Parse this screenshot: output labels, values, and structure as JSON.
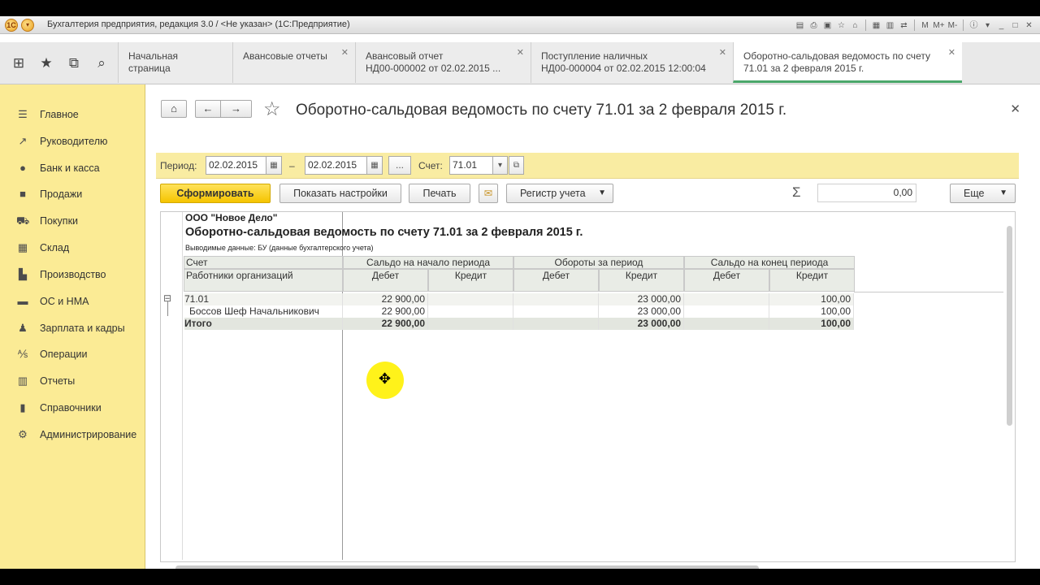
{
  "window": {
    "title": "Бухгалтерия предприятия, редакция 3.0 / <Не указан>  (1С:Предприятие)",
    "logo_text": "1С"
  },
  "tabs": [
    {
      "label": "Начальная страница"
    },
    {
      "label": "Авансовые отчеты"
    },
    {
      "line1": "Авансовый отчет",
      "line2": "НД00-000002 от 02.02.2015 ..."
    },
    {
      "line1": "Поступление наличных",
      "line2": "НД00-000004 от 02.02.2015 12:00:04"
    },
    {
      "line1": "Оборотно-сальдовая ведомость по счету",
      "line2": "71.01 за 2 февраля 2015 г."
    }
  ],
  "sidebar": {
    "items": [
      {
        "label": "Главное",
        "icon": "menu-icon"
      },
      {
        "label": "Руководителю",
        "icon": "chart-icon"
      },
      {
        "label": "Банк и касса",
        "icon": "coins-icon"
      },
      {
        "label": "Продажи",
        "icon": "bag-icon"
      },
      {
        "label": "Покупки",
        "icon": "cart-icon"
      },
      {
        "label": "Склад",
        "icon": "warehouse-icon"
      },
      {
        "label": "Производство",
        "icon": "factory-icon"
      },
      {
        "label": "ОС и НМА",
        "icon": "truck-icon"
      },
      {
        "label": "Зарплата и кадры",
        "icon": "people-icon"
      },
      {
        "label": "Операции",
        "icon": "operations-icon"
      },
      {
        "label": "Отчеты",
        "icon": "report-icon"
      },
      {
        "label": "Справочники",
        "icon": "book-icon"
      },
      {
        "label": "Администрирование",
        "icon": "gear-icon"
      }
    ]
  },
  "form": {
    "title": "Оборотно-сальдовая ведомость по счету 71.01 за 2 февраля 2015 г.",
    "params": {
      "period_label": "Период:",
      "date_from": "02.02.2015",
      "dash": "–",
      "date_to": "02.02.2015",
      "dots": "...",
      "account_label": "Счет:",
      "account": "71.01"
    },
    "commands": {
      "generate": "Сформировать",
      "show_settings": "Показать настройки",
      "print": "Печать",
      "register": "Регистр учета",
      "sigma": "Σ",
      "sum_value": "0,00",
      "more": "Еще"
    }
  },
  "report": {
    "org": "ООО \"Новое Дело\"",
    "title": "Оборотно-сальдовая ведомость по счету 71.01 за 2 февраля 2015 г.",
    "output": "Выводимые данные:  БУ (данные бухгалтерского учета)",
    "headers": {
      "account": "Счет",
      "subconto": "Работники организаций",
      "opening": "Сальдо на начало периода",
      "turnover": "Обороты за период",
      "closing": "Сальдо на конец периода",
      "debit": "Дебет",
      "credit": "Кредит"
    },
    "rows": [
      {
        "name": "71.01",
        "open_debit": "22 900,00",
        "open_credit": "",
        "turn_debit": "",
        "turn_credit": "23 000,00",
        "close_debit": "",
        "close_credit": "100,00"
      },
      {
        "name": "Боссов Шеф Начальникович",
        "open_debit": "22 900,00",
        "open_credit": "",
        "turn_debit": "",
        "turn_credit": "23 000,00",
        "close_debit": "",
        "close_credit": "100,00"
      },
      {
        "name": "Итого",
        "open_debit": "22 900,00",
        "open_credit": "",
        "turn_debit": "",
        "turn_credit": "23 000,00",
        "close_debit": "",
        "close_credit": "100,00"
      }
    ],
    "collapse_symbol": "⊟"
  }
}
